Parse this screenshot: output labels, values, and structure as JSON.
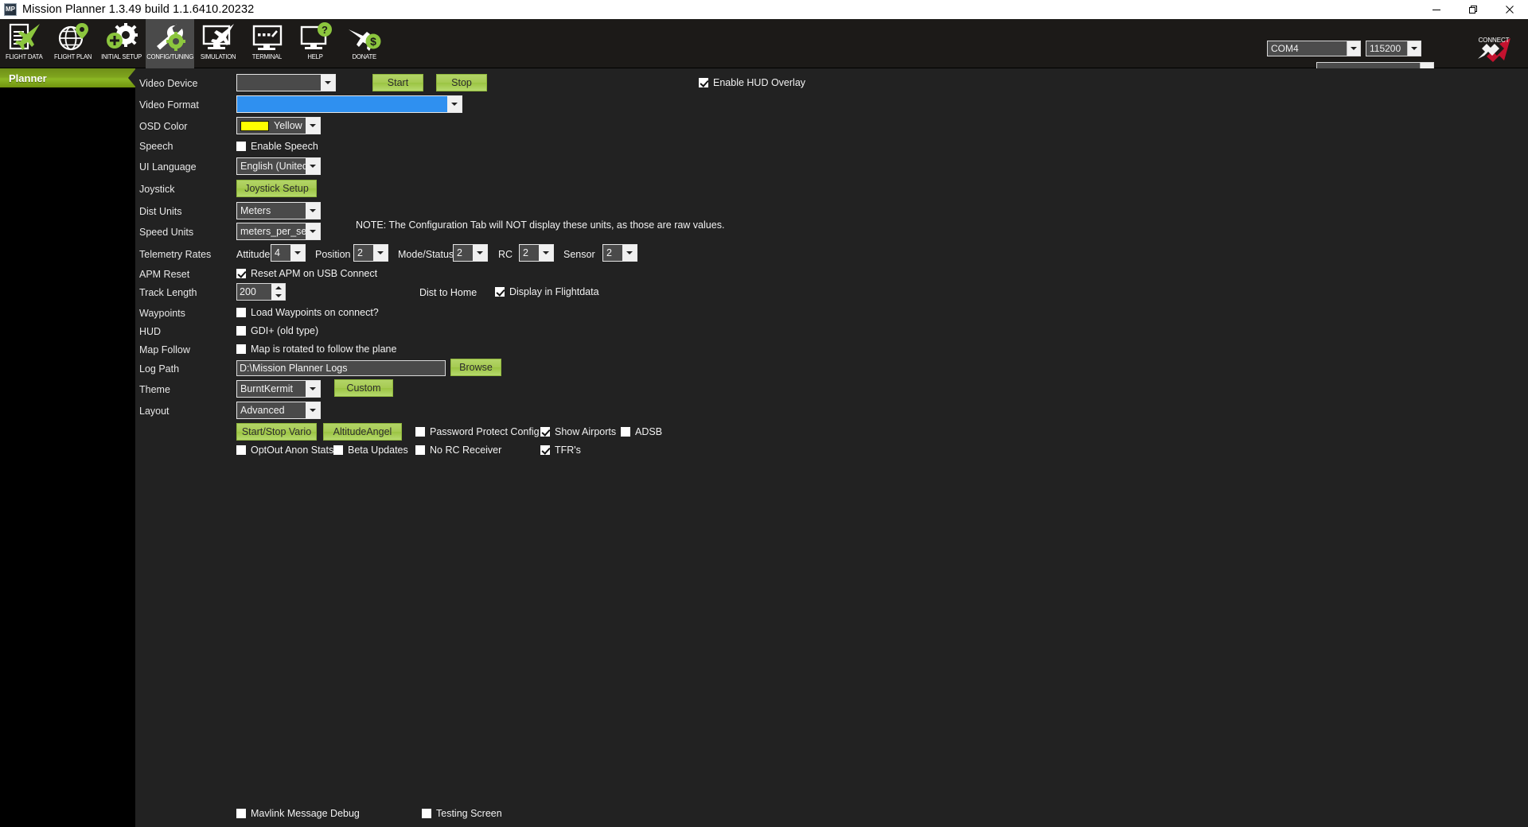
{
  "window": {
    "title": "Mission Planner 1.3.49 build 1.1.6410.20232",
    "app_icon_text": "MP",
    "minimize_label": "Minimize",
    "maximize_label": "Restore",
    "close_label": "Close"
  },
  "nav": {
    "items": [
      {
        "label": "FLIGHT DATA",
        "icon": "flight-data-icon",
        "active": false
      },
      {
        "label": "FLIGHT PLAN",
        "icon": "flight-plan-icon",
        "active": false
      },
      {
        "label": "INITIAL SETUP",
        "icon": "initial-setup-icon",
        "active": false
      },
      {
        "label": "CONFIG/TUNING",
        "icon": "config-tuning-icon",
        "active": true
      },
      {
        "label": "SIMULATION",
        "icon": "simulation-icon",
        "active": false
      },
      {
        "label": "TERMINAL",
        "icon": "terminal-icon",
        "active": false
      },
      {
        "label": "HELP",
        "icon": "help-icon",
        "active": false
      },
      {
        "label": "DONATE",
        "icon": "donate-icon",
        "active": false
      }
    ]
  },
  "connection": {
    "port": "COM4",
    "baud": "115200",
    "extra": "",
    "connect_label": "CONNECT"
  },
  "subtab": {
    "planner_label": "Planner"
  },
  "colors": {
    "accent_green": "#9bc442",
    "panel_bg": "#222222",
    "selection_blue": "#2f90f0",
    "osd_yellow": "#ffff00",
    "connect_red": "#c4122f"
  },
  "form": {
    "video_device": {
      "label": "Video Device",
      "value": "",
      "start_label": "Start",
      "stop_label": "Stop",
      "hud_overlay_label": "Enable HUD Overlay",
      "hud_overlay_checked": true
    },
    "video_format": {
      "label": "Video Format",
      "value": "",
      "selected": true
    },
    "osd_color": {
      "label": "OSD Color",
      "value": "Yellow",
      "swatch": "#ffff00"
    },
    "speech": {
      "label": "Speech",
      "checkbox_label": "Enable Speech",
      "checked": false
    },
    "ui_language": {
      "label": "UI Language",
      "value": "English (United States)"
    },
    "joystick": {
      "label": "Joystick",
      "button_label": "Joystick Setup"
    },
    "dist_units": {
      "label": "Dist Units",
      "value": "Meters"
    },
    "speed_units": {
      "label": "Speed Units",
      "value": "meters_per_second",
      "note": "NOTE: The Configuration Tab will NOT display these units, as those are raw values."
    },
    "telemetry_rates": {
      "label": "Telemetry Rates",
      "fields": [
        {
          "label": "Attitude",
          "value": "4"
        },
        {
          "label": "Position",
          "value": "2"
        },
        {
          "label": "Mode/Status",
          "value": "2"
        },
        {
          "label": "RC",
          "value": "2"
        },
        {
          "label": "Sensor",
          "value": "2"
        }
      ]
    },
    "apm_reset": {
      "label": "APM Reset",
      "checkbox_label": "Reset APM on USB Connect",
      "checked": true
    },
    "track_length": {
      "label": "Track Length",
      "value": "200",
      "dist_to_home_label": "Dist to Home",
      "display_flightdata_label": "Display in Flightdata",
      "display_flightdata_checked": true
    },
    "waypoints": {
      "label": "Waypoints",
      "checkbox_label": "Load Waypoints on connect?",
      "checked": false
    },
    "hud": {
      "label": "HUD",
      "checkbox_label": "GDI+ (old type)",
      "checked": false
    },
    "map_follow": {
      "label": "Map Follow",
      "checkbox_label": "Map is rotated to follow the plane",
      "checked": false
    },
    "log_path": {
      "label": "Log Path",
      "value": "D:\\Mission Planner Logs",
      "browse_label": "Browse"
    },
    "theme": {
      "label": "Theme",
      "value": "BurntKermit",
      "custom_label": "Custom"
    },
    "layout": {
      "label": "Layout",
      "value": "Advanced"
    },
    "action_row": {
      "vario_label": "Start/Stop Vario",
      "altitude_angel_label": "AltitudeAngel",
      "password_protect_label": "Password Protect Config",
      "password_protect_checked": false,
      "show_airports_label": "Show Airports",
      "show_airports_checked": true,
      "adsb_label": "ADSB",
      "adsb_checked": false
    },
    "options_row": {
      "optout_label": "OptOut Anon Stats",
      "optout_checked": false,
      "beta_label": "Beta Updates",
      "beta_checked": false,
      "norc_label": "No RC Receiver",
      "norc_checked": false,
      "tfr_label": "TFR's",
      "tfr_checked": true
    },
    "bottom_row": {
      "mavlink_debug_label": "Mavlink Message Debug",
      "mavlink_debug_checked": false,
      "testing_screen_label": "Testing Screen",
      "testing_screen_checked": false
    }
  }
}
